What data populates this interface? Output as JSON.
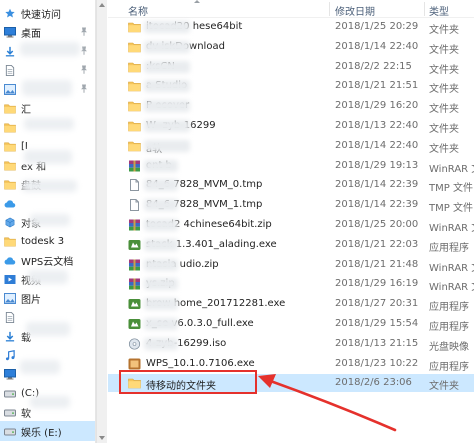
{
  "nav": {
    "items": [
      {
        "label": "快速访问",
        "icon": "star-icon"
      },
      {
        "label": "桌面",
        "icon": "desktop-icon"
      },
      {
        "label": "",
        "icon": "download-icon"
      },
      {
        "label": "",
        "icon": "document-icon"
      },
      {
        "label": "",
        "icon": "picture-icon"
      },
      {
        "label": "汇",
        "icon": "folder-icon"
      },
      {
        "label": "",
        "icon": "folder-icon"
      },
      {
        "label": "[I",
        "icon": "folder-icon"
      },
      {
        "label": "ex    和",
        "icon": "folder-icon"
      },
      {
        "label": "    盘鼓",
        "icon": "folder-icon"
      },
      {
        "label": "",
        "icon": "cloud-icon"
      },
      {
        "label": "对象",
        "icon": "3d-object-icon"
      },
      {
        "label": "todesk 3",
        "icon": "folder-icon"
      },
      {
        "label": "WPS云文档",
        "icon": "cloud-icon"
      },
      {
        "label": "视频",
        "icon": "video-icon"
      },
      {
        "label": "图片",
        "icon": "picture-icon"
      },
      {
        "label": "",
        "icon": "document-icon"
      },
      {
        "label": "载",
        "icon": "download-icon"
      },
      {
        "label": "",
        "icon": "music-icon"
      },
      {
        "label": "",
        "icon": "desktop-icon"
      },
      {
        "label": "(C:)",
        "icon": "drive-icon"
      },
      {
        "label": "软",
        "icon": "drive-icon"
      },
      {
        "label": "娱乐 (E:)",
        "icon": "drive-icon"
      }
    ]
  },
  "header": {
    "name": "名称",
    "date": "修改日期",
    "type": "类型"
  },
  "files": [
    {
      "name": "    itocad20    hese64bit",
      "date": "2018/1/25 20:29",
      "type": "文件夹",
      "icon": "folder-icon"
    },
    {
      "name": "    dv    iskDownload",
      "date": "2018/1/14 22:40",
      "type": "文件夹",
      "icon": "folder-icon"
    },
    {
      "name": "         :ksCN",
      "date": "2018/2/2 22:15",
      "type": "文件夹",
      "icon": "folder-icon"
    },
    {
      "name": "         a Studio",
      "date": "2018/1/21 21:51",
      "type": "文件夹",
      "icon": "folder-icon"
    },
    {
      "name": "P       ecover",
      "date": "2018/1/29 16:20",
      "type": "文件夹",
      "icon": "folder-icon"
    },
    {
      "name": "W        -zyb-16299",
      "date": "2018/1/13 22:40",
      "type": "文件夹",
      "icon": "folder-icon"
    },
    {
      "name": "         a软",
      "date": "2018/1/14 22:40",
      "type": "文件夹",
      "icon": "folder-icon"
    },
    {
      "name": "         ont     b",
      "date": "2018/1/29 19:13",
      "type": "WinRAR 文",
      "icon": "rar-icon"
    },
    {
      "name": "    84_6    7828_MVM_0.tmp",
      "date": "2018/1/14 22:39",
      "type": "TMP 文件",
      "icon": "file-icon"
    },
    {
      "name": "    84_6    7828_MVM_1.tmp",
      "date": "2018/1/14 22:39",
      "type": "TMP 文件",
      "icon": "file-icon"
    },
    {
      "name": "    tocad2    4chinese64bit.zip",
      "date": "2018/1/25 20:00",
      "type": "WinRAR 文",
      "icon": "rar-icon"
    },
    {
      "name": "    stack    1.3.401_alading.exe",
      "date": "2018/1/21 22:03",
      "type": "应用程序",
      "icon": "exe-icon"
    },
    {
      "name": "    ntasia    udio.zip",
      "date": "2018/1/21 21:48",
      "type": "WinRAR 文",
      "icon": "rar-icon"
    },
    {
      "name": "    ys.zip",
      "date": "2018/1/29 16:19",
      "type": "WinRAR 文",
      "icon": "rar-icon"
    },
    {
      "name": "    brow    home_201712281.exe",
      "date": "2018/1/27 20:31",
      "type": "应用程序",
      "icon": "exe-icon"
    },
    {
      "name": "    x_se    v6.0.3.0_full.exe",
      "date": "2018/1/29 15:54",
      "type": "应用程序",
      "icon": "exe-icon"
    },
    {
      "name": "    4-zyb-16299.iso",
      "date": "2018/1/13 21:15",
      "type": "光盘映像",
      "icon": "iso-icon"
    },
    {
      "name": "WPS_10.1.0.7106.exe",
      "date": "2018/1/23 10:22",
      "type": "应用程序",
      "icon": "wps-icon"
    },
    {
      "name": "待移动的文件夹",
      "date": "2018/2/6 23:06",
      "type": "文件夹",
      "icon": "folder-icon",
      "selected": true
    }
  ],
  "colors": {
    "selection": "#cce8ff",
    "annotation": "#e5312c",
    "folder": "#f5c55b",
    "header_text": "#4c607a"
  }
}
